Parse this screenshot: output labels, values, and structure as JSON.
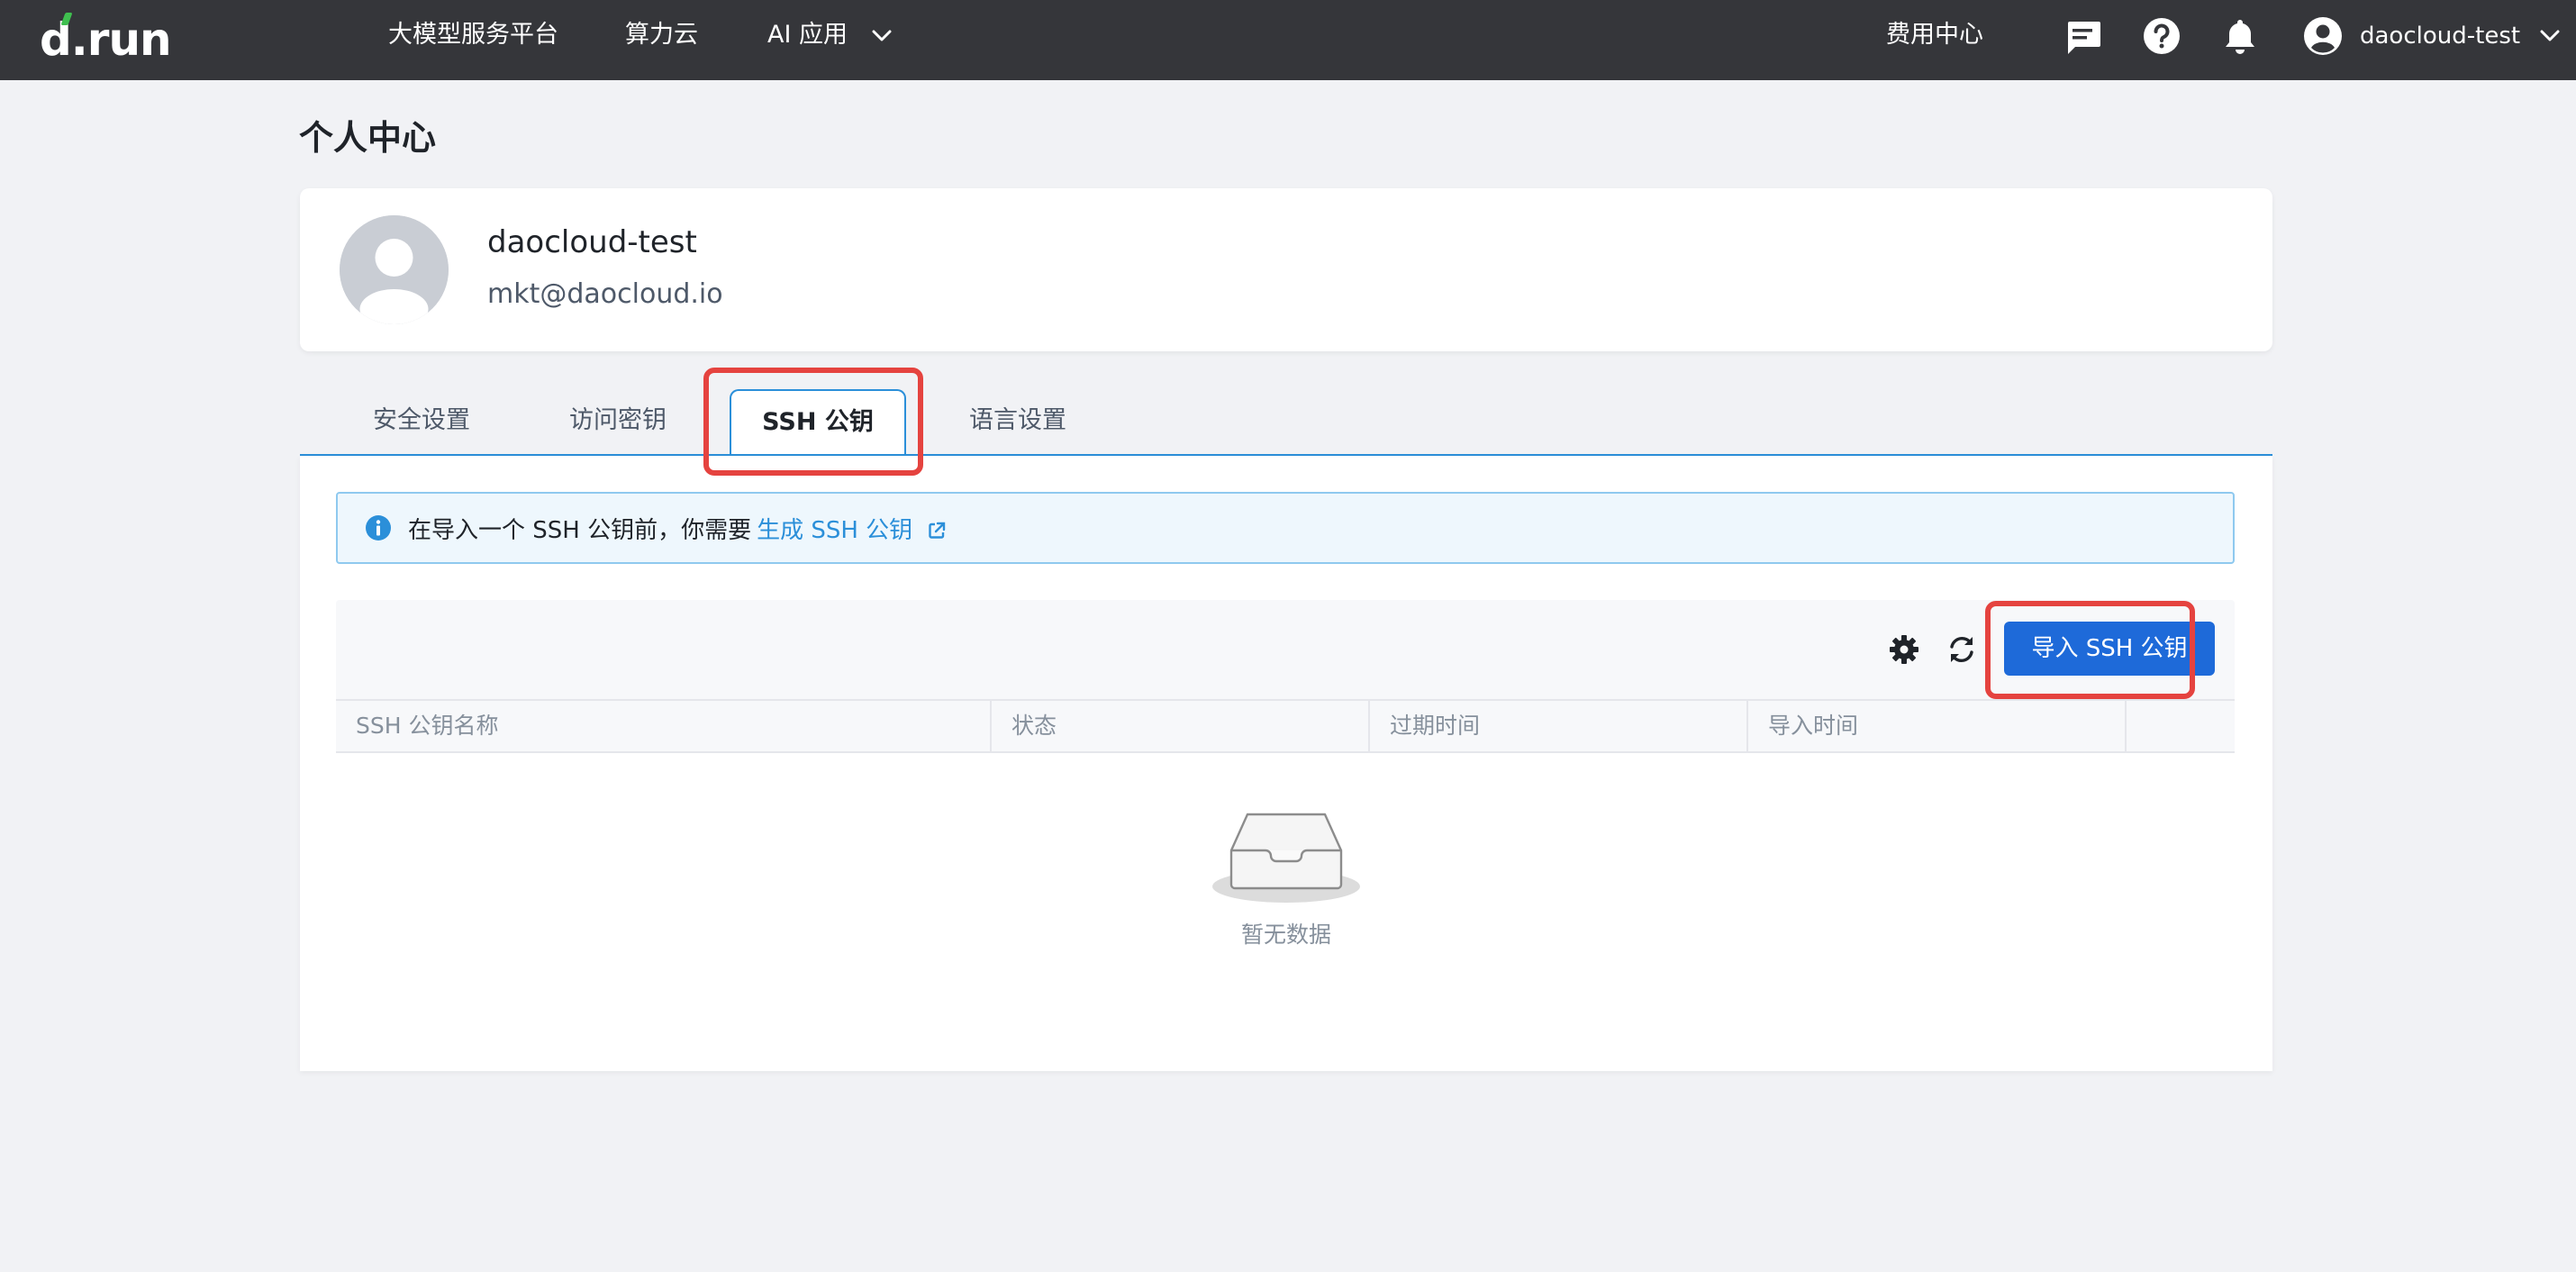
{
  "topbar": {
    "logo": "d.run",
    "nav": [
      {
        "label": "大模型服务平台"
      },
      {
        "label": "算力云"
      },
      {
        "label": "AI 应用"
      }
    ],
    "billing": "费用中心",
    "username": "daocloud-test",
    "icons": [
      "message-icon",
      "help-icon",
      "bell-icon",
      "user-icon",
      "chevron-down-icon"
    ]
  },
  "page": {
    "title": "个人中心"
  },
  "profile": {
    "name": "daocloud-test",
    "email": "mkt@daocloud.io"
  },
  "tabs": [
    {
      "label": "安全设置",
      "active": false
    },
    {
      "label": "访问密钥",
      "active": false
    },
    {
      "label": "SSH 公钥",
      "active": true
    },
    {
      "label": "语言设置",
      "active": false
    }
  ],
  "alert": {
    "text": "在导入一个 SSH 公钥前，你需要",
    "link": "生成 SSH 公钥"
  },
  "toolbar": {
    "import_label": "导入 SSH 公钥"
  },
  "table": {
    "columns": [
      "SSH 公钥名称",
      "状态",
      "过期时间",
      "导入时间"
    ],
    "rows": []
  },
  "empty": {
    "text": "暂无数据"
  },
  "colors": {
    "topbar": "#35363a",
    "accent": "#2b8fd9",
    "primary_button": "#1e6ad9",
    "highlight": "#e5433f"
  }
}
